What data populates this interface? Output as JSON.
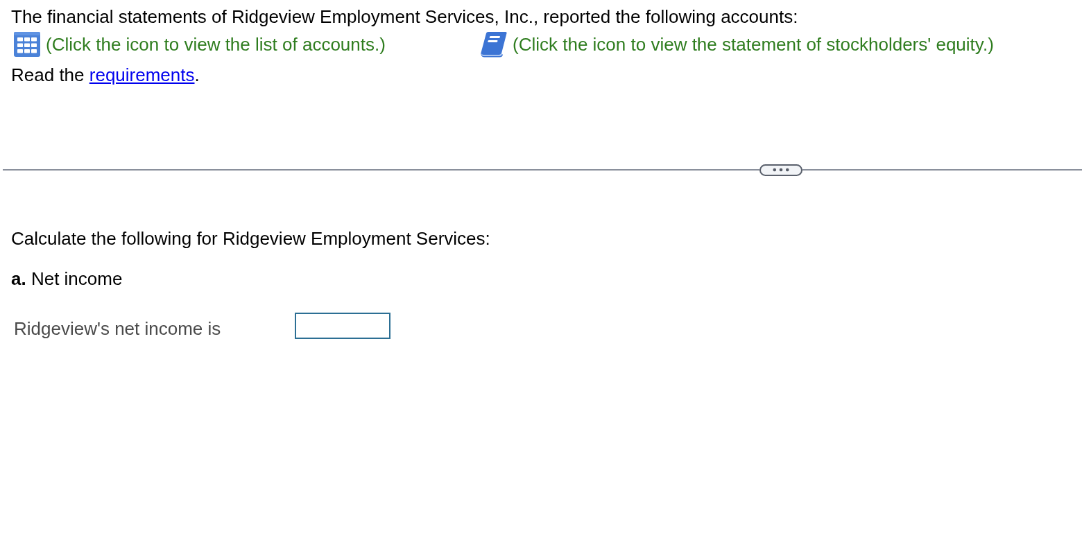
{
  "intro": {
    "text": "The financial statements of Ridgeview Employment Services, Inc., reported the following accounts:"
  },
  "resources": [
    {
      "kind": "table",
      "text": "(Click the icon to view the list of accounts.)"
    },
    {
      "kind": "book",
      "text": "(Click the icon to view the statement of stockholders' equity.)"
    }
  ],
  "requirements_line": {
    "before": "Read the",
    "link": "requirements",
    "after": "."
  },
  "question": {
    "prompt": "Calculate the following for Ridgeview Employment Services:",
    "parts": [
      {
        "heading": "**a.** Net income",
        "answer_label": "Ridgeview's net income is"
      }
    ]
  }
}
